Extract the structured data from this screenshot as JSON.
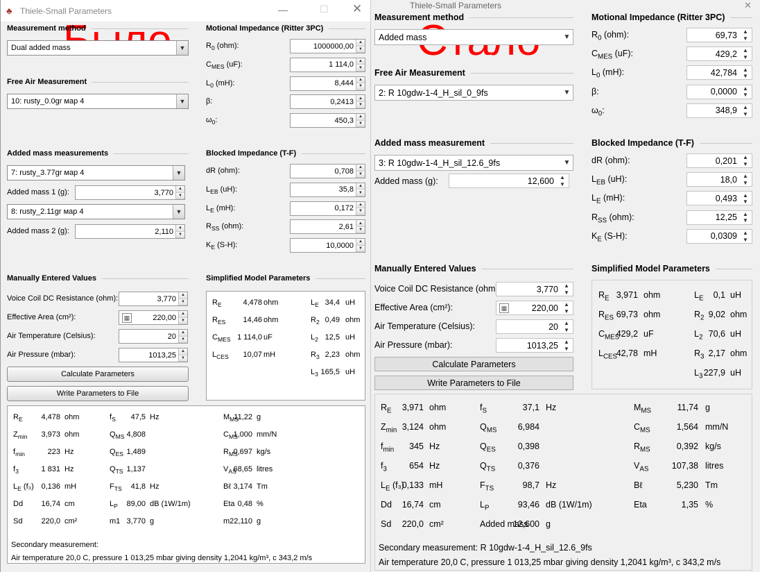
{
  "before": {
    "title": "Thiele-Small Parameters",
    "watermark": "Было",
    "measurement_method": {
      "header": "Measurement method",
      "value": "Dual added mass"
    },
    "free_air": {
      "header": "Free Air Measurement",
      "value": "10: rusty_0.0gr мар 4"
    },
    "added_mass": {
      "header": "Added mass measurements",
      "combos": [
        "7: rusty_3.77gr мар 4",
        "8: rusty_2.11gr мар 4"
      ],
      "labels": [
        "Added mass 1 (g):",
        "Added mass 2 (g):"
      ],
      "values": [
        "3,770",
        "2,110"
      ]
    },
    "manual": {
      "header": "Manually Entered Values",
      "rows": [
        {
          "label": "Voice Coil DC Resistance (ohm):",
          "value": "3,770"
        },
        {
          "label": "Effective Area (cm²):",
          "value": "220,00"
        },
        {
          "label": "Air Temperature (Celsius):",
          "value": "20"
        },
        {
          "label": "Air Pressure (mbar):",
          "value": "1013,25"
        }
      ]
    },
    "buttons": {
      "calculate": "Calculate Parameters",
      "write": "Write Parameters to File"
    },
    "motional": {
      "header": "Motional Impedance (Ritter 3PC)",
      "rows": [
        {
          "label": [
            "R",
            "0",
            " (ohm):"
          ],
          "value": "1000000,00"
        },
        {
          "label": [
            "C",
            "MES",
            " (uF):"
          ],
          "value": "1 114,0"
        },
        {
          "label": [
            "L",
            "0",
            " (mH):"
          ],
          "value": "8,444"
        },
        {
          "label": [
            "β",
            "",
            ":"
          ],
          "value": "0,2413"
        },
        {
          "label": [
            "ω",
            "0",
            ":"
          ],
          "value": "450,3"
        }
      ]
    },
    "blocked": {
      "header": "Blocked Impedance (T-F)",
      "rows": [
        {
          "label": [
            "dR (ohm):",
            "",
            ""
          ],
          "value": "0,708"
        },
        {
          "label": [
            "L",
            "EB",
            " (uH):"
          ],
          "value": "35,8"
        },
        {
          "label": [
            "L",
            "E",
            " (mH):"
          ],
          "value": "0,172"
        },
        {
          "label": [
            "R",
            "SS",
            " (ohm):"
          ],
          "value": "2,61"
        },
        {
          "label": [
            "K",
            "E",
            " (S-H):"
          ],
          "value": "10,0000"
        }
      ]
    },
    "simplified": {
      "header": "Simplified Model Parameters",
      "left": [
        {
          "l": [
            "R",
            "E",
            ""
          ],
          "v": "4,478",
          "u": "ohm"
        },
        {
          "l": [
            "R",
            "ES",
            ""
          ],
          "v": "14,46",
          "u": "ohm"
        },
        {
          "l": [
            "C",
            "MES",
            ""
          ],
          "v": "1 114,0",
          "u": "uF"
        },
        {
          "l": [
            "L",
            "CES",
            ""
          ],
          "v": "10,07",
          "u": "mH"
        }
      ],
      "right": [
        {
          "l": [
            "L",
            "E",
            ""
          ],
          "v": "34,4",
          "u": "uH"
        },
        {
          "l": [
            "R",
            "2",
            ""
          ],
          "v": "0,49",
          "u": "ohm"
        },
        {
          "l": [
            "L",
            "2",
            ""
          ],
          "v": "12,5",
          "u": "uH"
        },
        {
          "l": [
            "R",
            "3",
            ""
          ],
          "v": "2,23",
          "u": "ohm"
        },
        {
          "l": [
            "L",
            "3",
            ""
          ],
          "v": "165,5",
          "u": "uH"
        }
      ]
    },
    "results": {
      "cols": [
        [
          {
            "l": [
              "R",
              "E",
              ""
            ],
            "v": "4,478",
            "u": "ohm"
          },
          {
            "l": [
              "Z",
              "min",
              ""
            ],
            "v": "3,973",
            "u": "ohm"
          },
          {
            "l": [
              "f",
              "min",
              ""
            ],
            "v": "223",
            "u": "Hz"
          },
          {
            "l": [
              "f",
              "3",
              ""
            ],
            "v": "1 831",
            "u": "Hz"
          },
          {
            "l": [
              "L",
              "E",
              " (f₃)"
            ],
            "v": "0,136",
            "u": "mH"
          },
          {
            "l": [
              "Dd",
              "",
              ""
            ],
            "v": "16,74",
            "u": "cm"
          },
          {
            "l": [
              "Sd",
              "",
              ""
            ],
            "v": "220,0",
            "u": "cm²"
          }
        ],
        [
          {
            "l": [
              "f",
              "S",
              ""
            ],
            "v": "47,5",
            "u": "Hz"
          },
          {
            "l": [
              "Q",
              "MS",
              ""
            ],
            "v": "4,808",
            "u": ""
          },
          {
            "l": [
              "Q",
              "ES",
              ""
            ],
            "v": "1,489",
            "u": ""
          },
          {
            "l": [
              "Q",
              "TS",
              ""
            ],
            "v": "1,137",
            "u": ""
          },
          {
            "l": [
              "F",
              "TS",
              ""
            ],
            "v": "41,8",
            "u": "Hz"
          },
          {
            "l": [
              "L",
              "P",
              ""
            ],
            "v": "89,00",
            "u": "dB (1W/1m)"
          },
          {
            "l": [
              "m1",
              "",
              ""
            ],
            "v": "3,770",
            "u": "g"
          }
        ],
        [
          {
            "l": [
              "M",
              "MS",
              ""
            ],
            "v": "11,22",
            "u": "g"
          },
          {
            "l": [
              "C",
              "MS",
              ""
            ],
            "v": "1,000",
            "u": "mm/N"
          },
          {
            "l": [
              "R",
              "MS",
              ""
            ],
            "v": "0,697",
            "u": "kg/s"
          },
          {
            "l": [
              "V",
              "AS",
              ""
            ],
            "v": "68,65",
            "u": "litres"
          },
          {
            "l": [
              "Bℓ",
              "",
              ""
            ],
            "v": "3,174",
            "u": "Tm"
          },
          {
            "l": [
              "Eta",
              "",
              ""
            ],
            "v": "0,48",
            "u": "%"
          },
          {
            "l": [
              "m2",
              "",
              ""
            ],
            "v": "2,110",
            "u": "g"
          }
        ]
      ],
      "secondary": "Secondary measurement:",
      "air": "Air temperature 20,0 C, pressure 1 013,25 mbar giving density 1,2041 kg/m³, c 343,2 m/s"
    }
  },
  "after": {
    "title": "Thiele-Small Parameters",
    "watermark": "Стало",
    "measurement_method": {
      "header": "Measurement method",
      "value": "Added mass"
    },
    "free_air": {
      "header": "Free Air Measurement",
      "value": "2: R 10gdw-1-4_H_sil_0_9fs"
    },
    "added_mass": {
      "header": "Added mass measurement",
      "combos": [
        "3: R 10gdw-1-4_H_sil_12.6_9fs"
      ],
      "labels": [
        "Added mass (g):"
      ],
      "values": [
        "12,600"
      ]
    },
    "manual": {
      "header": "Manually Entered Values",
      "rows": [
        {
          "label": "Voice Coil DC Resistance (ohm):",
          "value": "3,770"
        },
        {
          "label": "Effective Area (cm²):",
          "value": "220,00"
        },
        {
          "label": "Air Temperature (Celsius):",
          "value": "20"
        },
        {
          "label": "Air Pressure (mbar):",
          "value": "1013,25"
        }
      ]
    },
    "buttons": {
      "calculate": "Calculate Parameters",
      "write": "Write Parameters to File"
    },
    "motional": {
      "header": "Motional Impedance (Ritter 3PC)",
      "rows": [
        {
          "label": [
            "R",
            "0",
            " (ohm):"
          ],
          "value": "69,73"
        },
        {
          "label": [
            "C",
            "MES",
            " (uF):"
          ],
          "value": "429,2"
        },
        {
          "label": [
            "L",
            "0",
            " (mH):"
          ],
          "value": "42,784"
        },
        {
          "label": [
            "β",
            "",
            ":"
          ],
          "value": "0,0000"
        },
        {
          "label": [
            "ω",
            "0",
            ":"
          ],
          "value": "348,9"
        }
      ]
    },
    "blocked": {
      "header": "Blocked Impedance (T-F)",
      "rows": [
        {
          "label": [
            "dR (ohm):",
            "",
            ""
          ],
          "value": "0,201"
        },
        {
          "label": [
            "L",
            "EB",
            " (uH):"
          ],
          "value": "18,0"
        },
        {
          "label": [
            "L",
            "E",
            " (mH):"
          ],
          "value": "0,493"
        },
        {
          "label": [
            "R",
            "SS",
            " (ohm):"
          ],
          "value": "12,25"
        },
        {
          "label": [
            "K",
            "E",
            " (S-H):"
          ],
          "value": "0,0309"
        }
      ]
    },
    "simplified": {
      "header": "Simplified Model Parameters",
      "left": [
        {
          "l": [
            "R",
            "E",
            ""
          ],
          "v": "3,971",
          "u": "ohm"
        },
        {
          "l": [
            "R",
            "ES",
            ""
          ],
          "v": "69,73",
          "u": "ohm"
        },
        {
          "l": [
            "C",
            "MES",
            ""
          ],
          "v": "429,2",
          "u": "uF"
        },
        {
          "l": [
            "L",
            "CES",
            ""
          ],
          "v": "42,78",
          "u": "mH"
        }
      ],
      "right": [
        {
          "l": [
            "L",
            "E",
            ""
          ],
          "v": "0,1",
          "u": "uH"
        },
        {
          "l": [
            "R",
            "2",
            ""
          ],
          "v": "9,02",
          "u": "ohm"
        },
        {
          "l": [
            "L",
            "2",
            ""
          ],
          "v": "70,6",
          "u": "uH"
        },
        {
          "l": [
            "R",
            "3",
            ""
          ],
          "v": "2,17",
          "u": "ohm"
        },
        {
          "l": [
            "L",
            "3",
            ""
          ],
          "v": "227,9",
          "u": "uH"
        }
      ]
    },
    "results": {
      "cols": [
        [
          {
            "l": [
              "R",
              "E",
              ""
            ],
            "v": "3,971",
            "u": "ohm"
          },
          {
            "l": [
              "Z",
              "min",
              ""
            ],
            "v": "3,124",
            "u": "ohm"
          },
          {
            "l": [
              "f",
              "min",
              ""
            ],
            "v": "345",
            "u": "Hz"
          },
          {
            "l": [
              "f",
              "3",
              ""
            ],
            "v": "654",
            "u": "Hz"
          },
          {
            "l": [
              "L",
              "E",
              " (f₃)"
            ],
            "v": "0,133",
            "u": "mH"
          },
          {
            "l": [
              "Dd",
              "",
              ""
            ],
            "v": "16,74",
            "u": "cm"
          },
          {
            "l": [
              "Sd",
              "",
              ""
            ],
            "v": "220,0",
            "u": "cm²"
          }
        ],
        [
          {
            "l": [
              "f",
              "S",
              ""
            ],
            "v": "37,1",
            "u": "Hz"
          },
          {
            "l": [
              "Q",
              "MS",
              ""
            ],
            "v": "6,984",
            "u": ""
          },
          {
            "l": [
              "Q",
              "ES",
              ""
            ],
            "v": "0,398",
            "u": ""
          },
          {
            "l": [
              "Q",
              "TS",
              ""
            ],
            "v": "0,376",
            "u": ""
          },
          {
            "l": [
              "F",
              "TS",
              ""
            ],
            "v": "98,7",
            "u": "Hz"
          },
          {
            "l": [
              "L",
              "P",
              ""
            ],
            "v": "93,46",
            "u": "dB (1W/1m)"
          },
          {
            "l": [
              "Added mass",
              "",
              ""
            ],
            "v": "12,600",
            "u": "g"
          }
        ],
        [
          {
            "l": [
              "M",
              "MS",
              ""
            ],
            "v": "11,74",
            "u": "g"
          },
          {
            "l": [
              "C",
              "MS",
              ""
            ],
            "v": "1,564",
            "u": "mm/N"
          },
          {
            "l": [
              "R",
              "MS",
              ""
            ],
            "v": "0,392",
            "u": "kg/s"
          },
          {
            "l": [
              "V",
              "AS",
              ""
            ],
            "v": "107,38",
            "u": "litres"
          },
          {
            "l": [
              "Bℓ",
              "",
              ""
            ],
            "v": "5,230",
            "u": "Tm"
          },
          {
            "l": [
              "Eta",
              "",
              ""
            ],
            "v": "1,35",
            "u": "%"
          }
        ]
      ],
      "secondary": "Secondary measurement: R 10gdw-1-4_H_sil_12.6_9fs",
      "air": "Air temperature 20,0 C, pressure 1 013,25 mbar giving density 1,2041 kg/m³, c 343,2 m/s"
    }
  }
}
